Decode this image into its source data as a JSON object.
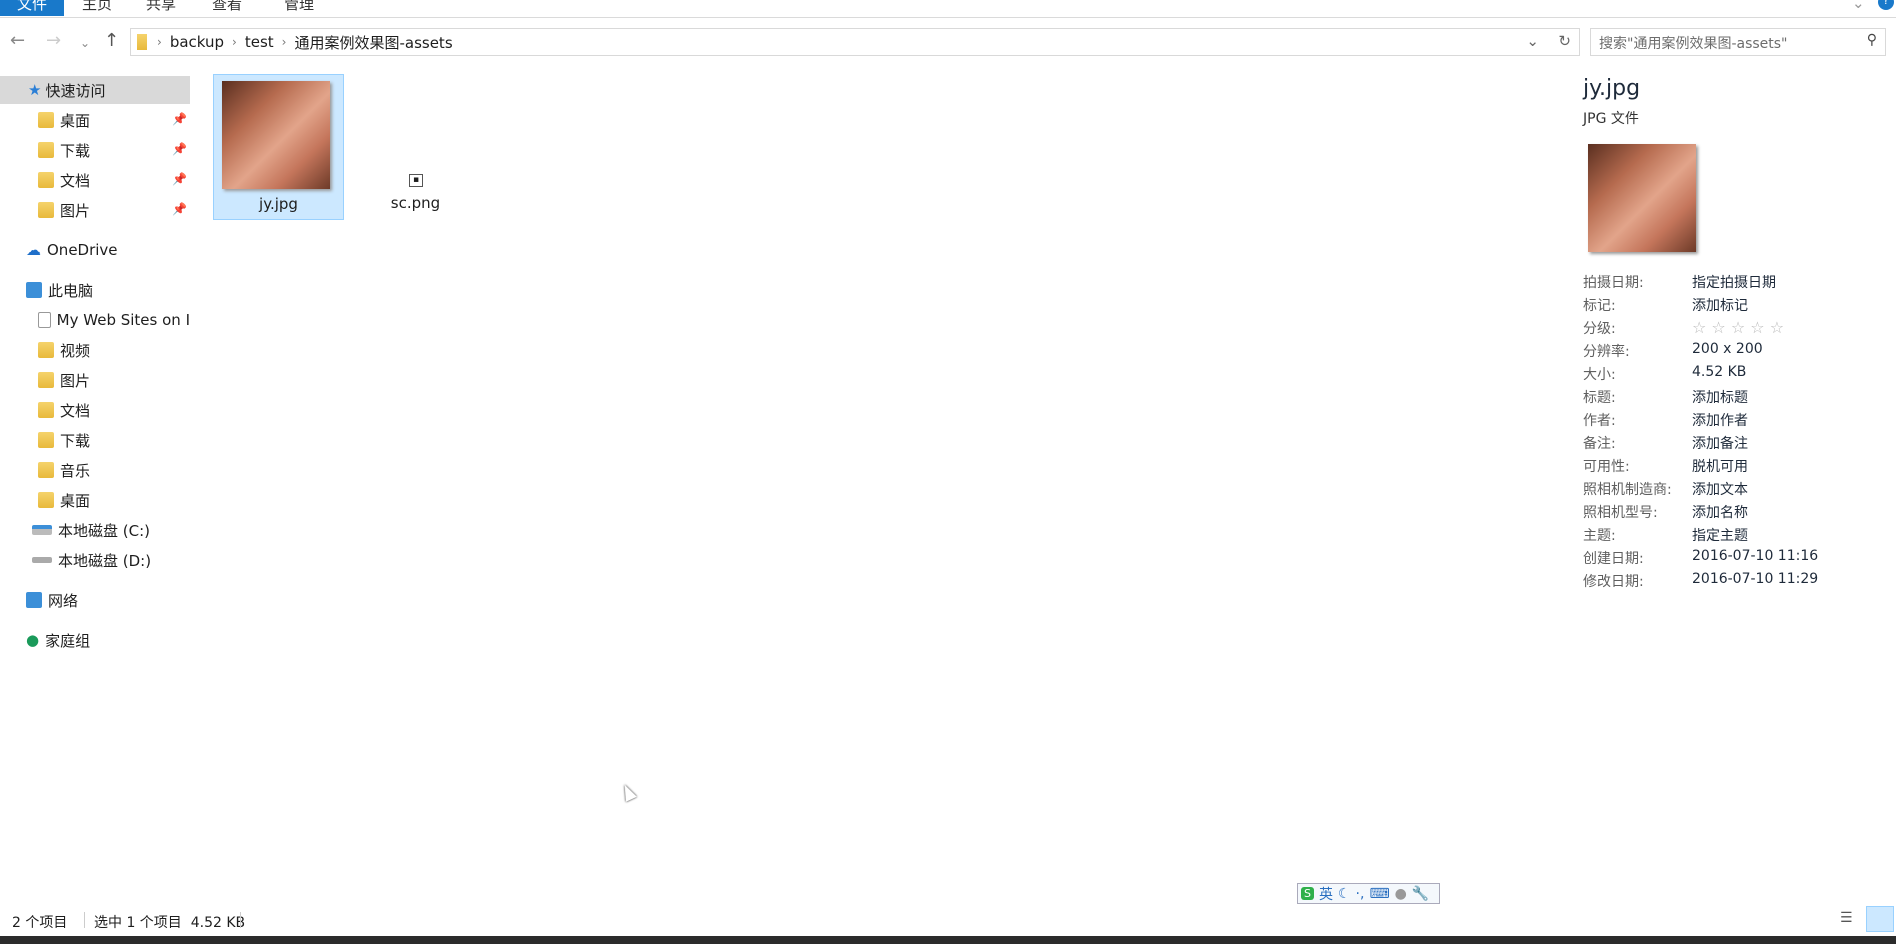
{
  "ribbon": {
    "tabs": [
      "文件",
      "主页",
      "共享",
      "查看",
      "管理"
    ]
  },
  "address": {
    "crumbs": [
      "backup",
      "test",
      "通用案例效果图-assets"
    ],
    "search_placeholder": "搜索\"通用案例效果图-assets\""
  },
  "sidebar": {
    "quick_access": "快速访问",
    "quick_items": [
      "桌面",
      "下载",
      "文档",
      "图片"
    ],
    "onedrive": "OneDrive",
    "this_pc": "此电脑",
    "pc_items": [
      "My Web Sites on I",
      "视频",
      "图片",
      "文档",
      "下载",
      "音乐",
      "桌面",
      "本地磁盘 (C:)",
      "本地磁盘 (D:)"
    ],
    "network": "网络",
    "homegroup": "家庭组"
  },
  "files": [
    {
      "name": "jy.jpg",
      "selected": true
    },
    {
      "name": "sc.png",
      "selected": false
    }
  ],
  "details": {
    "filename": "jy.jpg",
    "filetype": "JPG 文件",
    "rating": 0,
    "props": [
      {
        "label": "拍摄日期:",
        "value": "指定拍摄日期"
      },
      {
        "label": "标记:",
        "value": "添加标记"
      },
      {
        "label": "分级:",
        "value": "☆ ☆ ☆ ☆ ☆"
      },
      {
        "label": "分辨率:",
        "value": "200 x 200"
      },
      {
        "label": "大小:",
        "value": "4.52 KB"
      },
      {
        "label": "标题:",
        "value": "添加标题"
      },
      {
        "label": "作者:",
        "value": "添加作者"
      },
      {
        "label": "备注:",
        "value": "添加备注"
      },
      {
        "label": "可用性:",
        "value": "脱机可用"
      },
      {
        "label": "照相机制造商:",
        "value": "添加文本"
      },
      {
        "label": "照相机型号:",
        "value": "添加名称"
      },
      {
        "label": "主题:",
        "value": "指定主题"
      },
      {
        "label": "创建日期:",
        "value": "2016-07-10 11:16"
      },
      {
        "label": "修改日期:",
        "value": "2016-07-10 11:29"
      }
    ]
  },
  "status": {
    "count": "2 个项目",
    "selection": "选中 1 个项目  4.52 KB"
  },
  "ime": {
    "mode": "英"
  },
  "colors": {
    "accent": "#1979ca",
    "selection": "#cce8ff"
  }
}
